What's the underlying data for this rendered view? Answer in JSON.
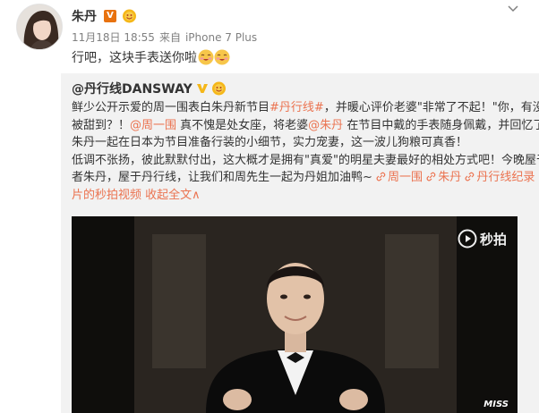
{
  "post": {
    "author": "朱丹",
    "verified_badge": "V",
    "time": "11月18日 18:55",
    "source_prefix": "来自",
    "source": "iPhone 7 Plus",
    "text": "行吧，这块手表送你啦"
  },
  "repost": {
    "author": "@丹行线DANSWAY",
    "lines": [
      {
        "segments": [
          {
            "text": "鲜少公开示爱的周一围表白朱丹新节目",
            "type": "text"
          },
          {
            "text": "#丹行线#",
            "type": "link"
          },
          {
            "text": "，并暖心评价老婆\"非常了不起！\"你，有没有",
            "type": "text"
          }
        ]
      },
      {
        "segments": [
          {
            "text": "被甜到？！",
            "type": "text"
          },
          {
            "text": "@周一围",
            "type": "link"
          },
          {
            "text": " 真不愧是处女座，将老婆",
            "type": "text"
          },
          {
            "text": "@朱丹",
            "type": "link"
          },
          {
            "text": " 在节目中戴的手表随身佩戴，并回忆了与",
            "type": "text"
          }
        ]
      },
      {
        "segments": [
          {
            "text": "朱丹一起在日本为节目准备行装的小细节，实力宠妻，这一波儿狗粮可真香！",
            "type": "text"
          }
        ]
      },
      {
        "segments": [
          {
            "text": "低调不张扬，彼此默默付出，这大概才是拥有\"真爱\"的明星夫妻最好的相处方式吧！今晚屋于行",
            "type": "text"
          }
        ]
      },
      {
        "segments": [
          {
            "text": "者朱丹，屋于丹行线，让我们和周先生一起为丹姐加油鸭~ ",
            "type": "text"
          },
          {
            "text": "周一围",
            "type": "iconlink"
          },
          {
            "text": " ",
            "type": "text"
          },
          {
            "text": "朱丹",
            "type": "iconlink"
          },
          {
            "text": " ",
            "type": "text"
          },
          {
            "text": "丹行线纪录",
            "type": "iconlink"
          }
        ]
      },
      {
        "segments": [
          {
            "text": "片的秒拍视频",
            "type": "link"
          },
          {
            "text": " ",
            "type": "text"
          },
          {
            "text": "收起全文",
            "type": "link"
          },
          {
            "text": "∧",
            "type": "link"
          }
        ]
      }
    ],
    "video": {
      "platform": "秒拍",
      "watermark": "MISS"
    }
  },
  "colors": {
    "link": "#eb7350",
    "repost_bg": "#f2f2f2",
    "badge_orange": "#e8720f",
    "badge_yellow": "#f5b719"
  },
  "icons": [
    "avatar",
    "verified-v-icon",
    "medal-icon",
    "more-caret-icon",
    "laugh-emoji-icon",
    "link-icon",
    "play-icon"
  ]
}
